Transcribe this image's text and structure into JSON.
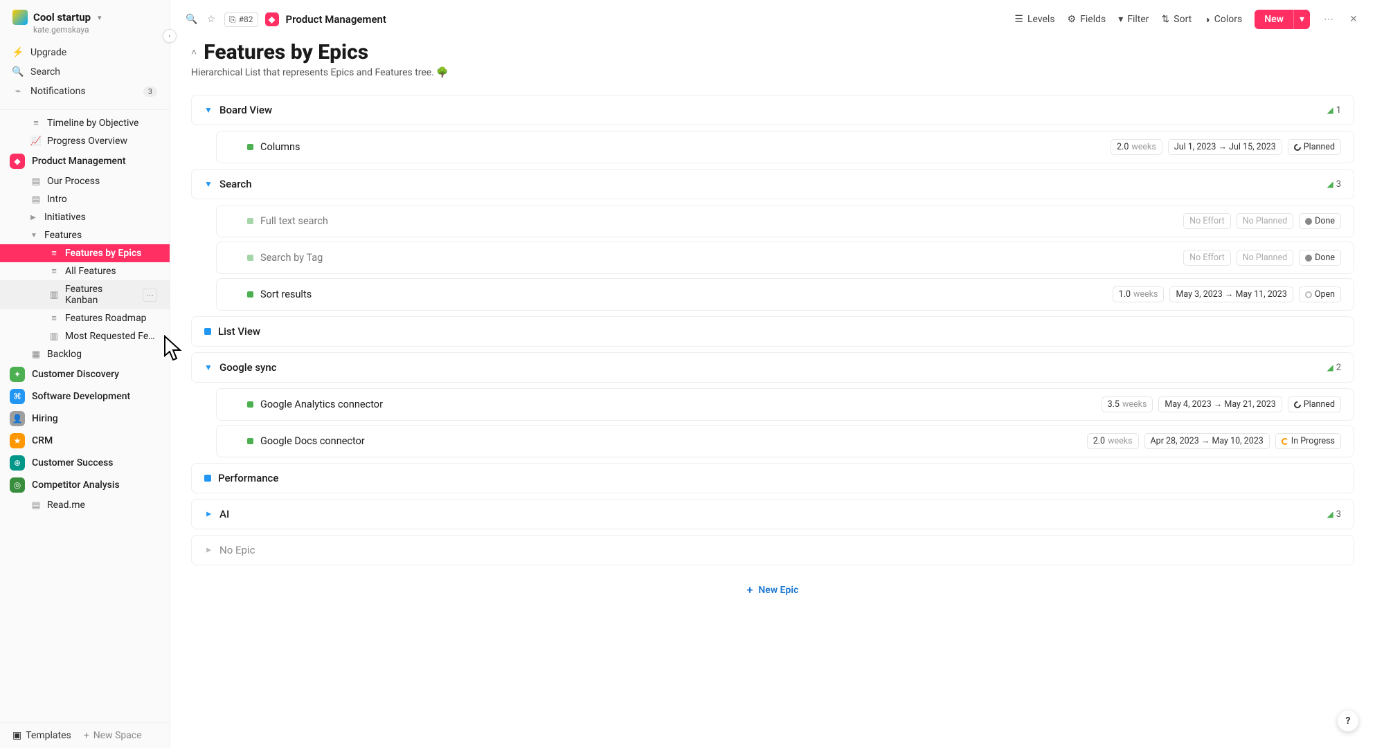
{
  "workspace": {
    "name": "Cool startup",
    "user": "kate.gemskaya"
  },
  "sidebarTop": {
    "upgrade": "Upgrade",
    "search": "Search",
    "notifications": "Notifications",
    "notif_badge": "3"
  },
  "nav": {
    "timeline": "Timeline by Objective",
    "progress": "Progress Overview",
    "pm": "Product Management",
    "our_process": "Our Process",
    "intro": "Intro",
    "initiatives": "Initiatives",
    "features": "Features",
    "f_epics": "Features by Epics",
    "f_all": "All Features",
    "f_kanban": "Features Kanban",
    "f_roadmap": "Features Roadmap",
    "f_most": "Most Requested Fe…",
    "backlog": "Backlog",
    "cd": "Customer Discovery",
    "sd": "Software Development",
    "hiring": "Hiring",
    "crm": "CRM",
    "cs": "Customer Success",
    "ca": "Competitor Analysis",
    "readme": "Read.me"
  },
  "sidebarFooter": {
    "templates": "Templates",
    "new_space": "New Space"
  },
  "topbar": {
    "ref": "#82",
    "space": "Product Management",
    "levels": "Levels",
    "fields": "Fields",
    "filter": "Filter",
    "sort": "Sort",
    "colors": "Colors",
    "new": "New"
  },
  "page": {
    "title": "Features by Epics",
    "desc": "Hierarchical List that represents Epics and Features tree. 🌳"
  },
  "groups": {
    "board_view": {
      "name": "Board View",
      "count": "1"
    },
    "search": {
      "name": "Search",
      "count": "3"
    },
    "list_view": {
      "name": "List View"
    },
    "google_sync": {
      "name": "Google sync",
      "count": "2"
    },
    "performance": {
      "name": "Performance"
    },
    "ai": {
      "name": "AI",
      "count": "3"
    },
    "no_epic": {
      "name": "No Epic"
    }
  },
  "features": {
    "columns": {
      "name": "Columns",
      "effort": "2.0",
      "unit": "weeks",
      "dates": "Jul 1, 2023 → Jul 15, 2023",
      "status": "Planned"
    },
    "fulltext": {
      "name": "Full text search",
      "no_effort": "No Effort",
      "no_planned": "No Planned",
      "status": "Done"
    },
    "search_tag": {
      "name": "Search by Tag",
      "no_effort": "No Effort",
      "no_planned": "No Planned",
      "status": "Done"
    },
    "sort": {
      "name": "Sort results",
      "effort": "1.0",
      "unit": "weeks",
      "dates": "May 3, 2023 → May 11, 2023",
      "status": "Open"
    },
    "ga": {
      "name": "Google Analytics connector",
      "effort": "3.5",
      "unit": "weeks",
      "dates": "May 4, 2023 → May 21, 2023",
      "status": "Planned"
    },
    "gd": {
      "name": "Google Docs connector",
      "effort": "2.0",
      "unit": "weeks",
      "dates": "Apr 28, 2023 → May 10, 2023",
      "status": "In Progress"
    }
  },
  "add_epic": "New Epic",
  "help": "?"
}
